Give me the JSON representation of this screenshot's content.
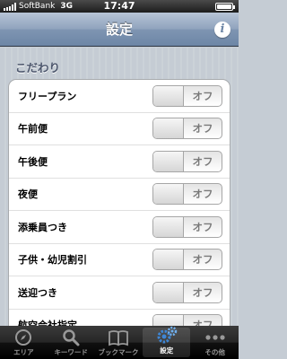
{
  "status_bar": {
    "carrier": "SoftBank",
    "network": "3G",
    "time": "17:47"
  },
  "nav": {
    "title": "設定",
    "info_label": "i"
  },
  "section": {
    "header": "こだわり"
  },
  "rows": [
    {
      "label": "フリープラン",
      "state": "オフ"
    },
    {
      "label": "午前便",
      "state": "オフ"
    },
    {
      "label": "午後便",
      "state": "オフ"
    },
    {
      "label": "夜便",
      "state": "オフ"
    },
    {
      "label": "添乗員つき",
      "state": "オフ"
    },
    {
      "label": "子供・幼児割引",
      "state": "オフ"
    },
    {
      "label": "送迎つき",
      "state": "オフ"
    },
    {
      "label": "航空会社指定",
      "state": "オフ"
    }
  ],
  "tabs": [
    {
      "label": "エリア",
      "icon": "compass-icon",
      "selected": false
    },
    {
      "label": "キーワード",
      "icon": "magnifier-icon",
      "selected": false
    },
    {
      "label": "ブックマーク",
      "icon": "book-icon",
      "selected": false
    },
    {
      "label": "設定",
      "icon": "gears-icon",
      "selected": true
    },
    {
      "label": "その他",
      "icon": "more-dots-icon",
      "selected": false
    }
  ],
  "colors": {
    "nav_bar": "#7f95b2",
    "section_header": "#4c566c",
    "selected_tab_icon": "#3e86d6"
  }
}
